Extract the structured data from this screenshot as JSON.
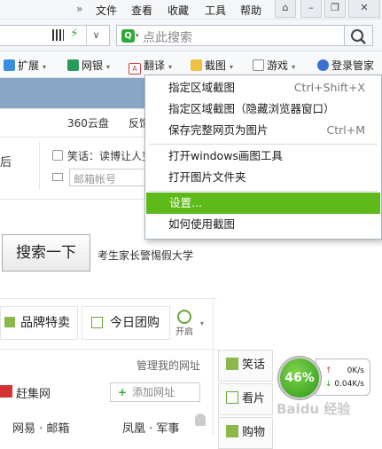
{
  "menubar": {
    "chevron": "»",
    "items": [
      "文件",
      "查看",
      "收藏",
      "工具",
      "帮助"
    ]
  },
  "addressbar": {
    "search_placeholder": "点此搜索"
  },
  "toolbar": {
    "items": [
      {
        "label": "扩展",
        "icon": "extension-icon",
        "color": "#3b8de0"
      },
      {
        "label": "网银",
        "icon": "bank-shield-icon",
        "color": "#2a9a5a"
      },
      {
        "label": "翻译",
        "icon": "translate-icon",
        "color": "#d04040"
      },
      {
        "label": "截图",
        "icon": "scissors-icon",
        "color": "#e0a020"
      },
      {
        "label": "游戏",
        "icon": "gamepad-icon",
        "color": "#777777"
      },
      {
        "label": "登录管家",
        "icon": "login-manager-icon",
        "color": "#3b6fd0"
      }
    ]
  },
  "page": {
    "links_top": [
      "360云盘",
      "反馈"
    ],
    "left_fragment": "后",
    "joke_label": "笑话：读博让人变",
    "email_placeholder": "邮箱帐号",
    "search_button": "搜索一下",
    "promo_text": "考生家长警惕假大学",
    "tabs": [
      "品牌特卖",
      "今日团购"
    ],
    "toggle_label": "开启",
    "manage_label": "管理我的网址",
    "add_site": "添加网址",
    "site_rows": [
      [
        "赶集网"
      ],
      [
        "网易 · 邮箱",
        "凤凰 · 军事"
      ]
    ],
    "side_buttons": [
      "笑话",
      "看片",
      "购物"
    ]
  },
  "context_menu": {
    "items": [
      {
        "label": "指定区域截图",
        "shortcut": "Ctrl+Shift+X"
      },
      {
        "label": "指定区域截图（隐藏浏览器窗口）",
        "shortcut": ""
      },
      {
        "label": "保存完整网页为图片",
        "shortcut": "Ctrl+M"
      },
      {
        "label": "打开windows画图工具",
        "shortcut": ""
      },
      {
        "label": "打开图片文件夹",
        "shortcut": ""
      },
      {
        "label": "设置...",
        "shortcut": "",
        "highlighted": true
      },
      {
        "label": "如何使用截图",
        "shortcut": ""
      }
    ]
  },
  "speed_widget": {
    "percent": "46%",
    "upload": "0K/s",
    "download": "0.04K/s"
  },
  "watermark": "Baidu 经验",
  "colors": {
    "highlight": "#5dba1a",
    "toolbar_bg": "#f4f6f8",
    "page_banner": "#8aa6c5"
  }
}
